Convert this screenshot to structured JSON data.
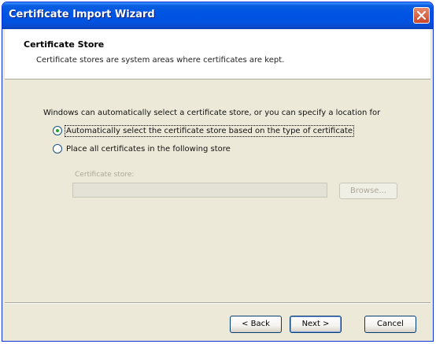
{
  "window": {
    "title": "Certificate Import Wizard"
  },
  "header": {
    "title": "Certificate Store",
    "subtitle": "Certificate stores are system areas where certificates are kept."
  },
  "main": {
    "description": "Windows can automatically select a certificate store, or you can specify a location for",
    "options": [
      {
        "label": "Automatically select the certificate store based on the type of certificate",
        "selected": true
      },
      {
        "label": "Place all certificates in the following store",
        "selected": false
      }
    ],
    "store_label": "Certificate store:",
    "store_value": "",
    "browse_label": "Browse..."
  },
  "footer": {
    "back_label": "< Back",
    "next_label": "Next >",
    "cancel_label": "Cancel"
  },
  "colors": {
    "titlebar": "#0054e3",
    "dialog_background": "#ece9d8",
    "disabled_text": "#aca899"
  }
}
